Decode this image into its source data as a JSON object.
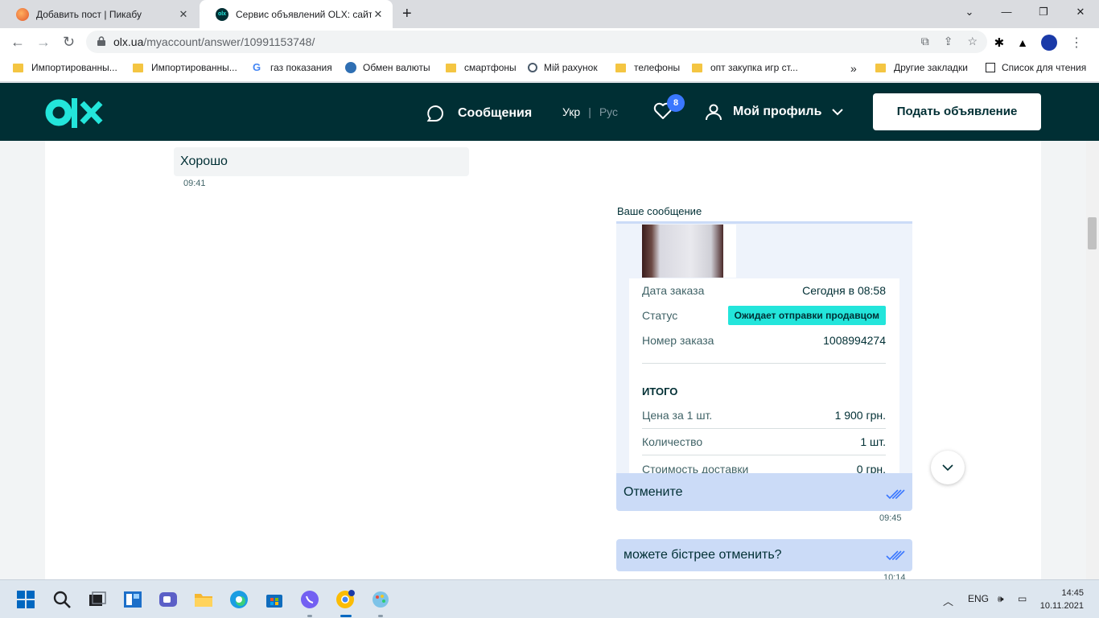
{
  "browser": {
    "tabs": [
      {
        "title": "Добавить пост | Пикабу",
        "active": false
      },
      {
        "title": "Сервис объявлений OLX: сайт ч",
        "active": true
      }
    ],
    "address": {
      "host": "olx.ua",
      "path": "/myaccount/answer/10991153748/"
    },
    "bookmarks": [
      {
        "label": "Импортированны...",
        "icon": "folder-icon"
      },
      {
        "label": "Импортированны...",
        "icon": "folder-icon"
      },
      {
        "label": "газ показания",
        "icon": "google-icon"
      },
      {
        "label": "Обмен валюты",
        "icon": "exchange-icon"
      },
      {
        "label": "смартфоны",
        "icon": "folder-icon"
      },
      {
        "label": "Мій рахунок",
        "icon": "account-icon"
      },
      {
        "label": "телефоны",
        "icon": "folder-icon"
      },
      {
        "label": "опт закупка игр ст...",
        "icon": "folder-icon"
      }
    ],
    "bookmarks_more": "»",
    "other_bookmarks": "Другие закладки",
    "reading_list": "Список для чтения"
  },
  "header": {
    "messages": "Сообщения",
    "lang_ukr": "Укр",
    "lang_rus": "Рус",
    "favorites_count": "8",
    "profile": "Мой профиль",
    "post_button": "Подать объявление"
  },
  "chat": {
    "incoming": {
      "text": "Хорошо",
      "time": "09:41"
    },
    "your_message_label": "Ваше сообщение",
    "order": {
      "date_label": "Дата заказа",
      "date_value": "Сегодня в 08:58",
      "status_label": "Статус",
      "status_value": "Ожидает отправки продавцом",
      "number_label": "Номер заказа",
      "number_value": "1008994274",
      "total_heading": "ИТОГО",
      "price_label": "Цена за 1 шт.",
      "price_value": "1 900 грн.",
      "qty_label": "Количество",
      "qty_value": "1 шт.",
      "delivery_label": "Стоимость доставки",
      "delivery_value": "0 грн."
    },
    "outgoing": [
      {
        "text": "Отмените",
        "time": "09:45"
      },
      {
        "text": "можете бістрее отменить?",
        "time": "10:14"
      }
    ]
  },
  "taskbar": {
    "lang": "ENG",
    "time": "14:45",
    "date": "10.11.2021"
  },
  "colors": {
    "olx_dark": "#002f34",
    "olx_teal": "#23e5db",
    "bubble_out": "#cbdbf7",
    "bubble_in": "#f2f4f5",
    "badge_blue": "#3a77ff"
  }
}
